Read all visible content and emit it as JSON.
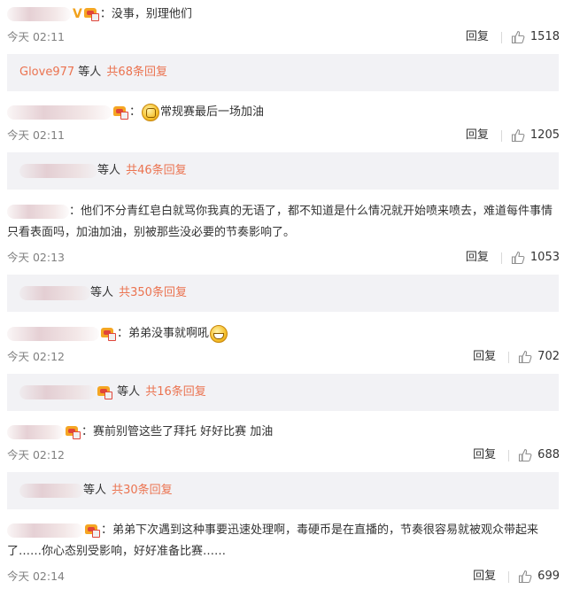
{
  "comments": [
    {
      "text": "：没事，别理他们",
      "time": "今天 02:11",
      "reply_label": "回复",
      "likes": "1518",
      "replies": {
        "user": "Glove977",
        "middle": " 等人 ",
        "total": "共68条回复"
      }
    },
    {
      "text": "：常规赛最后一场加油",
      "time": "今天 02:11",
      "reply_label": "回复",
      "likes": "1205",
      "replies": {
        "user": "",
        "middle": "等人 ",
        "total": "共46条回复"
      }
    },
    {
      "text": "：他们不分青红皂白就骂你我真的无语了，都不知道是什么情况就开始喷来喷去，难道每件事情只看表面吗，加油加油，别被那些没必要的节奏影响了。",
      "time": "今天 02:13",
      "reply_label": "回复",
      "likes": "1053",
      "replies": {
        "user": "",
        "middle": "等人 ",
        "total": "共350条回复"
      }
    },
    {
      "text": "：弟弟没事就啊吼",
      "time": "今天 02:12",
      "reply_label": "回复",
      "likes": "702",
      "replies": {
        "user": "",
        "middle": " 等人 ",
        "total": "共16条回复"
      }
    },
    {
      "text": "：赛前别管这些了拜托 好好比赛 加油",
      "time": "今天 02:12",
      "reply_label": "回复",
      "likes": "688",
      "replies": {
        "user": "",
        "middle": "等人 ",
        "total": "共30条回复"
      }
    },
    {
      "text": "：弟弟下次遇到这种事要迅速处理啊，毒硬币是在直播的，节奏很容易就被观众带起来了……你心态别受影响，好好准备比赛……",
      "time": "今天 02:14",
      "reply_label": "回复",
      "likes": "699"
    }
  ],
  "colors": {
    "link": "#eb7350",
    "meta": "#808080",
    "reply_bg": "#f2f2f5",
    "verified": "#f1a21d"
  },
  "icons": {
    "like": "thumbs-up-icon",
    "vip": "vip-crown-icon",
    "verified": "verified-v-icon"
  }
}
